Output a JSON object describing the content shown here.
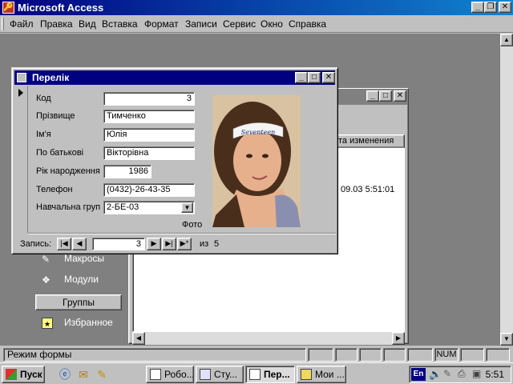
{
  "app": {
    "title": "Microsoft Access"
  },
  "menu": [
    "Файл",
    "Правка",
    "Вид",
    "Вставка",
    "Формат",
    "Записи",
    "Сервис",
    "Окно",
    "Справка"
  ],
  "dbwindow": {
    "column_header": "та изменения",
    "modified_value": "09.03 5:51:01",
    "objects": [
      {
        "label": "Макросы",
        "icon": "macro-icon"
      },
      {
        "label": "Модули",
        "icon": "module-icon"
      }
    ],
    "groups_label": "Группы",
    "favorites_label": "Избранное"
  },
  "form": {
    "title": "Перелік",
    "fields": [
      {
        "label": "Код",
        "value": "3"
      },
      {
        "label": "Прізвище",
        "value": "Тимченко"
      },
      {
        "label": "Ім'я",
        "value": "Юлія"
      },
      {
        "label": "По батькові",
        "value": "Вікторівна"
      },
      {
        "label": "Рік народження",
        "value": "1986"
      },
      {
        "label": "Телефон",
        "value": "(0432)-26-43-35"
      },
      {
        "label": "Навчальна груп",
        "value": "2-БЕ-03"
      }
    ],
    "photo_caption": "Фото",
    "headband_text": "Seventeen",
    "nav": {
      "label": "Запись:",
      "current": "3",
      "of_label": "из",
      "total": "5"
    }
  },
  "status": {
    "text": "Режим формы",
    "num": "NUM"
  },
  "taskbar": {
    "start": "Пуск",
    "buttons": [
      "Робо...",
      "Сту...",
      "Пер...",
      "Мои ..."
    ],
    "lang": "En",
    "clock": "5:51"
  }
}
